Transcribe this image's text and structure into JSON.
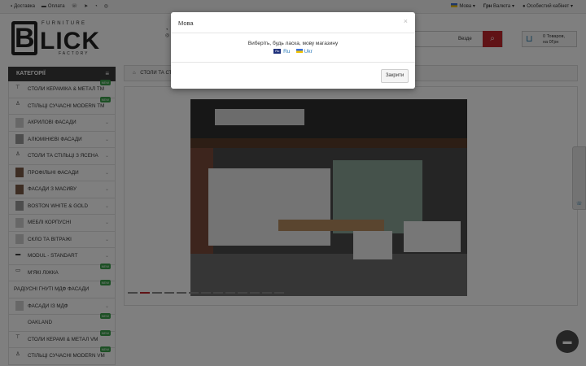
{
  "topbar": {
    "delivery": "Доставка",
    "payment": "Оплата",
    "language": "Мова",
    "currency_label": "Грн",
    "currency_word": "Валюта",
    "account": "Особистий кабінет"
  },
  "logo": {
    "b": "B",
    "lick": "LICK",
    "furniture": "FURNITURE",
    "factory": "FACTORY"
  },
  "search": {
    "category": "Везде"
  },
  "cart": {
    "line1": "0 Товаров,",
    "line2": "на 0Грн"
  },
  "sidebar": {
    "title": "КАТЕГОРІЇ",
    "items": [
      {
        "label": "СТОЛИ КЕРАМІКА & МЕТАЛ ТМ",
        "badge": "NEW"
      },
      {
        "label": "СТІЛЬЦІ СУЧАСНІ MODERN ТМ",
        "badge": "NEW"
      },
      {
        "label": "АКРИЛОВІ ФАСАДИ"
      },
      {
        "label": "АЛЮМІНІЄВІ ФАСАДИ"
      },
      {
        "label": "СТОЛИ ТА СТІЛЬЦІ З ЯСЕНА"
      },
      {
        "label": "ПРОФІЛЬНІ ФАСАДИ"
      },
      {
        "label": "ФАСАДИ З МАСИВУ"
      },
      {
        "label": "BOSTON WHITE & GOLD"
      },
      {
        "label": "МЕБЛІ КОРПУСНІ"
      },
      {
        "label": "СКЛО ТА ВІТРАЖІ"
      },
      {
        "label": "MODUL - STANDART"
      },
      {
        "label": "М'ЯКІ ЛІЖКА",
        "badge": "NEW"
      },
      {
        "label": "РАДІУСНІ ГНУТІ МДФ ФАСАДИ",
        "badge": "NEW"
      },
      {
        "label": "ФАСАДИ ІЗ МДФ"
      },
      {
        "label": "OAKLAND",
        "badge": "NEW"
      },
      {
        "label": "СТОЛИ КЕРАМІ & МЕТАЛ VM",
        "badge": "NEW"
      },
      {
        "label": "СТІЛЬЦІ СУЧАСНІ MODERN VM",
        "badge": "NEW"
      }
    ]
  },
  "breadcrumb": {
    "current": "СТОЛИ ТА СТ..."
  },
  "modal": {
    "title": "Мова",
    "close_x": "×",
    "prompt": "Виберіть, будь ласка, мову магазину",
    "lang_ru_icon": "Ru",
    "lang_ru": "Ru",
    "lang_ua": "Ukr",
    "close_button": "Закрити"
  }
}
